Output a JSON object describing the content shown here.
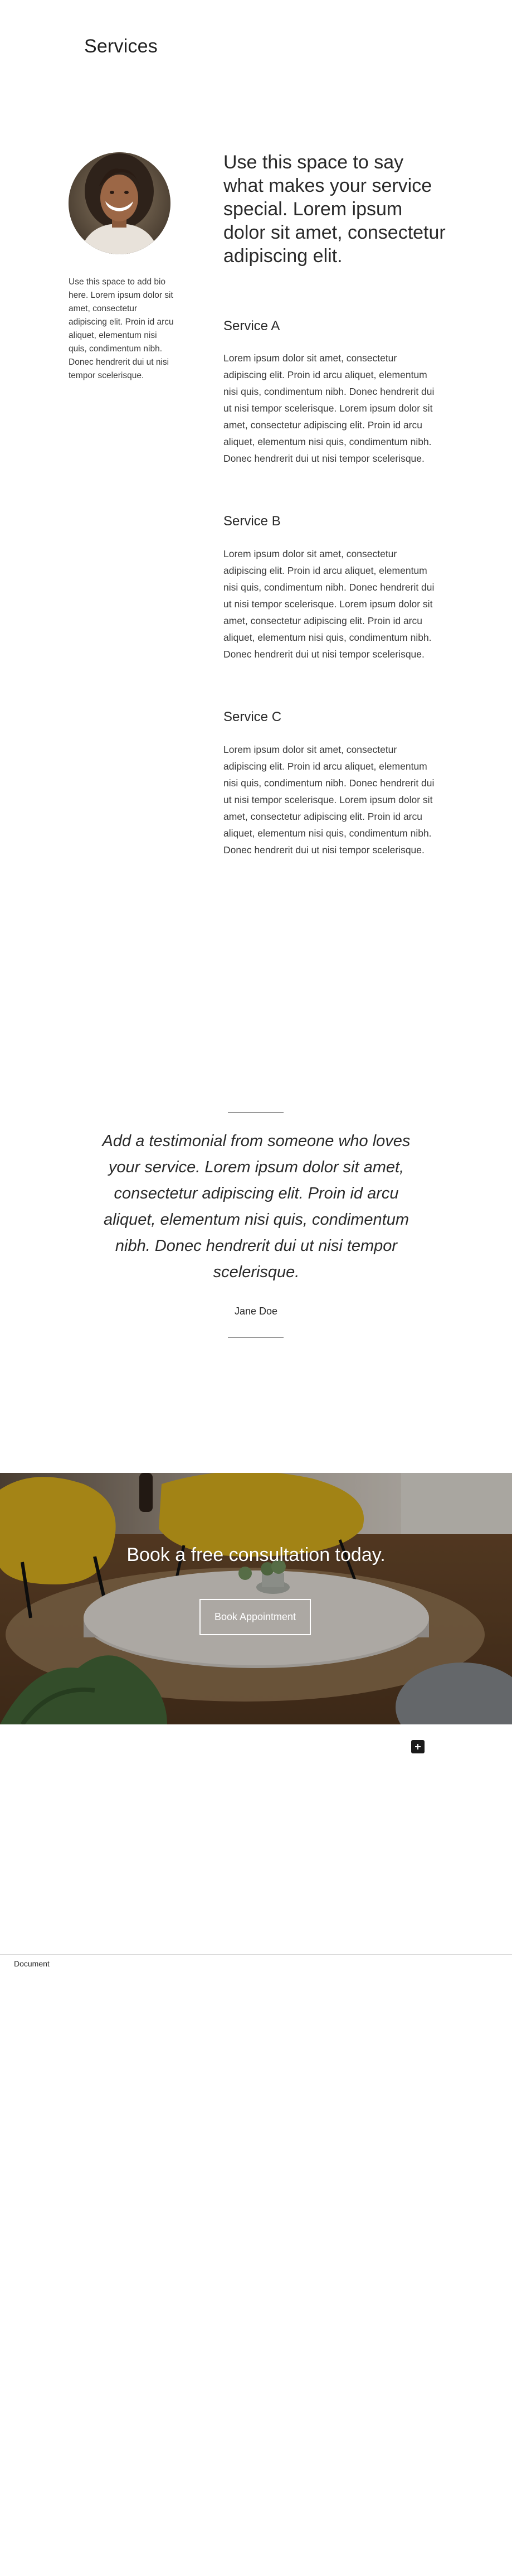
{
  "page": {
    "title": "Services"
  },
  "bio": {
    "avatar_icon": "portrait-photo",
    "text": "Use this space to add bio here. Lorem ipsum dolor sit amet, consectetur adipiscing elit. Proin id arcu aliquet, elementum nisi quis, condimentum nibh. Donec hendrerit dui ut nisi tempor scelerisque."
  },
  "intro": {
    "text": "Use this space to say what makes your service special. Lorem ipsum dolor sit amet, consectetur adipiscing elit."
  },
  "services": [
    {
      "title": "Service A",
      "body": "Lorem ipsum dolor sit amet, consectetur adipiscing elit. Proin id arcu aliquet, elementum nisi quis, condimentum nibh. Donec hendrerit dui ut nisi tempor scelerisque. Lorem ipsum dolor sit amet, consectetur adipiscing elit. Proin id arcu aliquet, elementum nisi quis, condimentum nibh. Donec hendrerit dui ut nisi tempor scelerisque."
    },
    {
      "title": "Service B",
      "body": "Lorem ipsum dolor sit amet, consectetur adipiscing elit. Proin id arcu aliquet, elementum nisi quis, condimentum nibh. Donec hendrerit dui ut nisi tempor scelerisque. Lorem ipsum dolor sit amet, consectetur adipiscing elit. Proin id arcu aliquet, elementum nisi quis, condimentum nibh. Donec hendrerit dui ut nisi tempor scelerisque."
    },
    {
      "title": "Service C",
      "body": "Lorem ipsum dolor sit amet, consectetur adipiscing elit. Proin id arcu aliquet, elementum nisi quis, condimentum nibh. Donec hendrerit dui ut nisi tempor scelerisque. Lorem ipsum dolor sit amet, consectetur adipiscing elit. Proin id arcu aliquet, elementum nisi quis, condimentum nibh. Donec hendrerit dui ut nisi tempor scelerisque."
    }
  ],
  "testimonial": {
    "quote": "Add a testimonial from someone who loves your service. Lorem ipsum dolor sit amet, consectetur adipiscing elit. Proin id arcu aliquet, elementum nisi quis, condimentum nibh. Donec hendrerit dui ut nisi tempor scelerisque.",
    "author": "Jane Doe"
  },
  "cta": {
    "heading": "Book a free consultation today.",
    "button_label": "Book Appointment",
    "background_icon": "living-room-photo"
  },
  "fab": {
    "icon": "plus-icon"
  },
  "footer": {
    "label": "Document"
  },
  "colors": {
    "text": "#2a2a2a",
    "rule": "#9a9a9a",
    "fab": "#1a1a1a"
  }
}
